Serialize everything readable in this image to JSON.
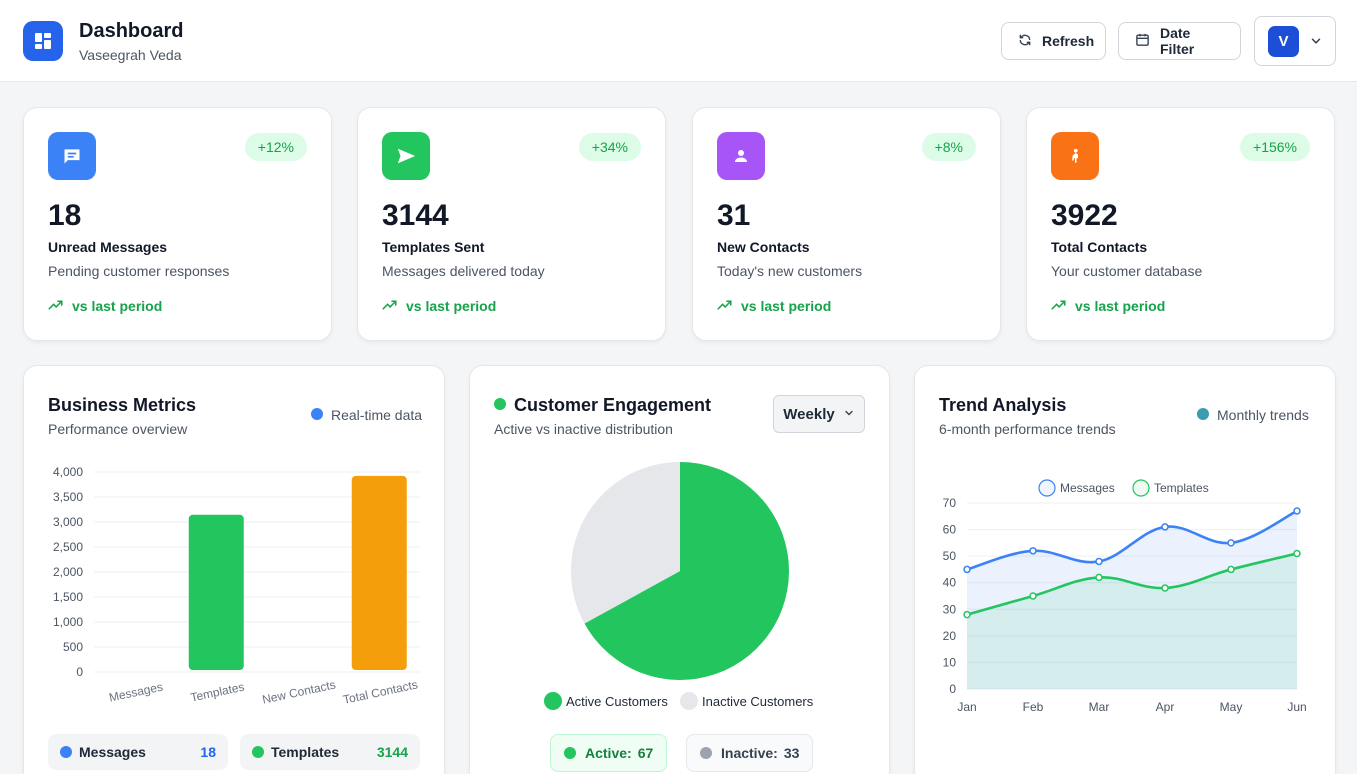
{
  "header": {
    "title": "Dashboard",
    "subtitle": "Vaseegrah Veda",
    "refresh_label": "Refresh",
    "date_filter_label": "Date Filter",
    "avatar_initial": "V"
  },
  "stats": [
    {
      "value": "18",
      "label": "Unread Messages",
      "desc": "Pending customer responses",
      "badge": "+12%",
      "trend": "vs last period",
      "color": "#3b82f6",
      "icon": "message-icon"
    },
    {
      "value": "3144",
      "label": "Templates Sent",
      "desc": "Messages delivered today",
      "badge": "+34%",
      "trend": "vs last period",
      "color": "#22c55e",
      "icon": "send-icon"
    },
    {
      "value": "31",
      "label": "New Contacts",
      "desc": "Today's new customers",
      "badge": "+8%",
      "trend": "vs last period",
      "color": "#a855f7",
      "icon": "person-icon"
    },
    {
      "value": "3922",
      "label": "Total Contacts",
      "desc": "Your customer database",
      "badge": "+156%",
      "trend": "vs last period",
      "color": "#f97316",
      "icon": "contacts-icon"
    }
  ],
  "business": {
    "title": "Business Metrics",
    "subtitle": "Performance overview",
    "legend": "Real-time data",
    "summary": [
      {
        "label": "Messages",
        "value": "18",
        "color": "#3b82f6"
      },
      {
        "label": "Templates",
        "value": "3144",
        "color": "#22c55e"
      }
    ]
  },
  "engagement": {
    "title": "Customer Engagement",
    "subtitle": "Active vs inactive distribution",
    "range": "Weekly",
    "legend_active": "Active Customers",
    "legend_inactive": "Inactive Customers",
    "active_label": "Active:",
    "active_value": "67",
    "inactive_label": "Inactive:",
    "inactive_value": "33"
  },
  "trend": {
    "title": "Trend Analysis",
    "subtitle": "6-month performance trends",
    "legend": "Monthly trends"
  },
  "chart_data": [
    {
      "type": "bar",
      "categories": [
        "Messages",
        "Templates",
        "New Contacts",
        "Total Contacts"
      ],
      "values": [
        18,
        3144,
        31,
        3922
      ],
      "colors": [
        "#3b82f6",
        "#22c55e",
        "#a855f7",
        "#f59e0b"
      ],
      "ylim": [
        0,
        4000
      ],
      "yticks": [
        "4,000",
        "3,500",
        "3,000",
        "2,500",
        "2,000",
        "1,500",
        "1,000",
        "500",
        "0"
      ]
    },
    {
      "type": "pie",
      "labels": [
        "Active Customers",
        "Inactive Customers"
      ],
      "values": [
        67,
        33
      ],
      "colors": [
        "#22c55e",
        "#e5e7eb"
      ]
    },
    {
      "type": "area",
      "categories": [
        "Jan",
        "Feb",
        "Mar",
        "Apr",
        "May",
        "Jun"
      ],
      "ylim": [
        0,
        70
      ],
      "yticks": [
        70,
        60,
        50,
        40,
        30,
        20,
        10,
        0
      ],
      "series": [
        {
          "name": "Messages",
          "values": [
            45,
            52,
            48,
            61,
            55,
            67
          ],
          "color": "#3b82f6"
        },
        {
          "name": "Templates",
          "values": [
            28,
            35,
            42,
            38,
            45,
            51
          ],
          "color": "#22c55e"
        }
      ]
    }
  ]
}
